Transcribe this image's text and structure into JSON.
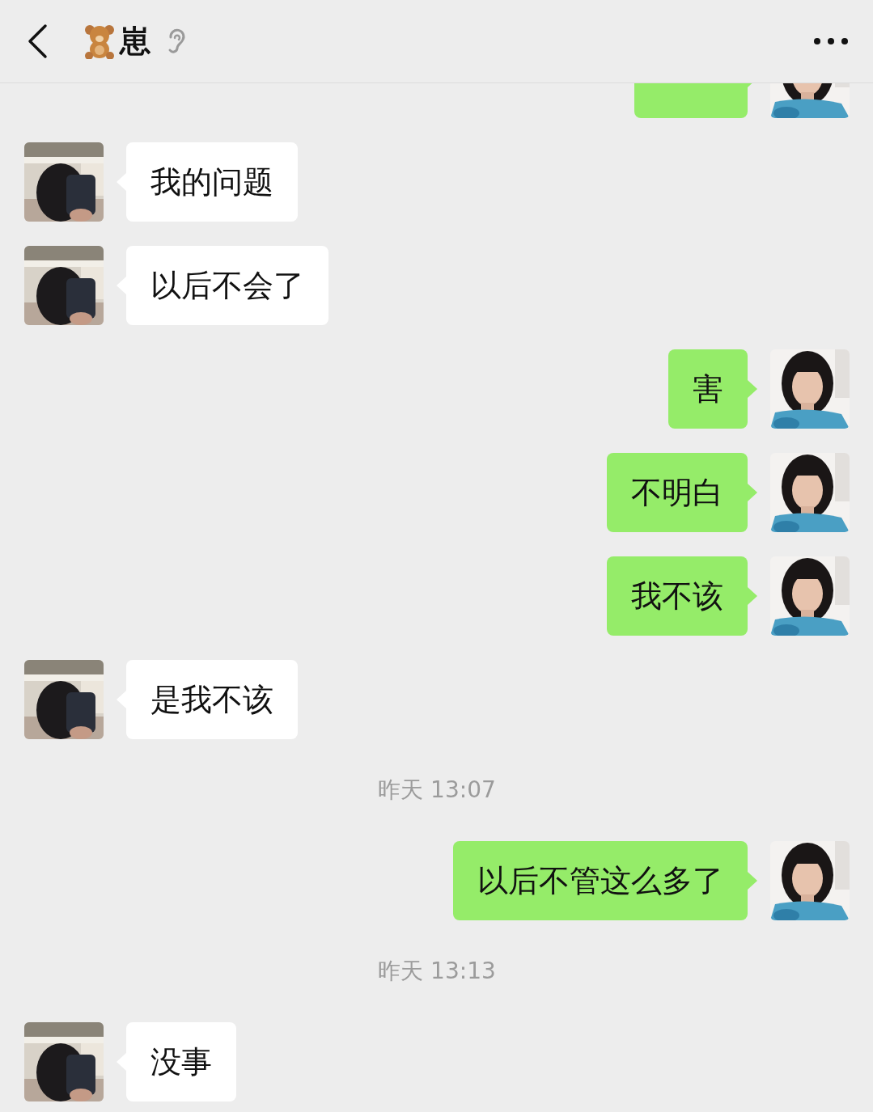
{
  "header": {
    "title": "崽"
  },
  "messages": [
    {
      "kind": "sent"
    },
    {
      "kind": "received",
      "text": "我的问题"
    },
    {
      "kind": "received",
      "text": "以后不会了"
    },
    {
      "kind": "sent",
      "text": "害"
    },
    {
      "kind": "sent",
      "text": "不明白"
    },
    {
      "kind": "sent",
      "text": "我不该"
    },
    {
      "kind": "received",
      "text": "是我不该"
    },
    {
      "kind": "time",
      "text": "昨天 13:07"
    },
    {
      "kind": "sent",
      "text": "以后不管这么多了"
    },
    {
      "kind": "time",
      "text": "昨天 13:13"
    },
    {
      "kind": "received",
      "text": "没事"
    }
  ]
}
